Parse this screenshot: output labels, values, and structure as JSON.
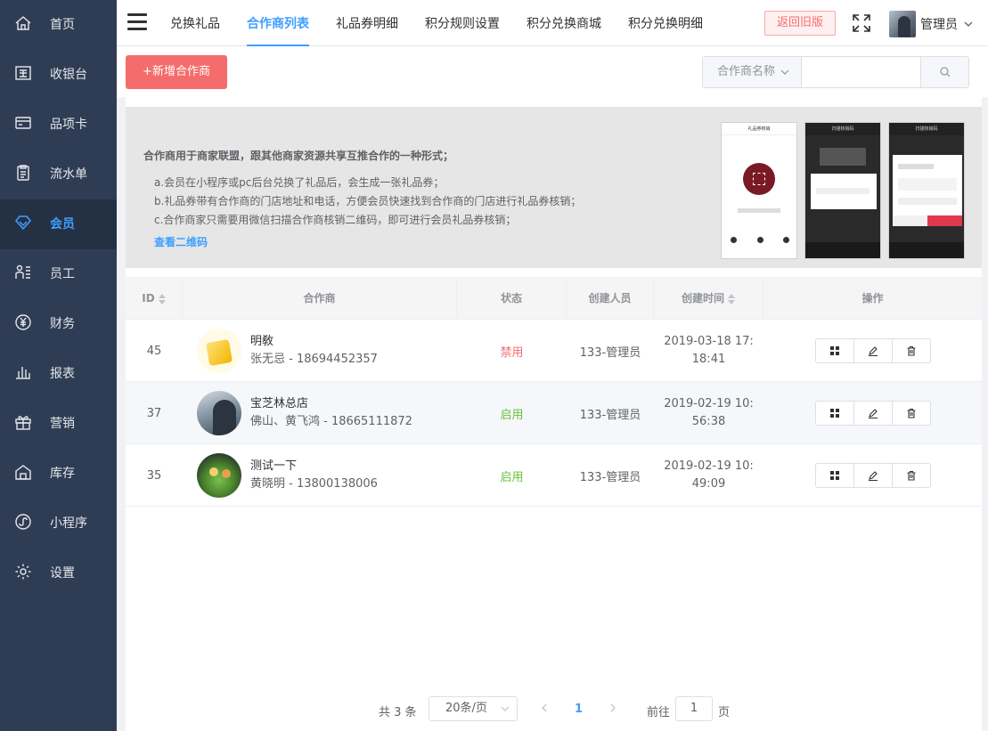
{
  "sidebar": {
    "items": [
      {
        "label": "首页",
        "icon": "home-icon",
        "active": false
      },
      {
        "label": "收银台",
        "icon": "cashier-icon",
        "active": false
      },
      {
        "label": "品项卡",
        "icon": "card-icon",
        "active": false
      },
      {
        "label": "流水单",
        "icon": "clipboard-icon",
        "active": false
      },
      {
        "label": "会员",
        "icon": "diamond-icon",
        "active": true
      },
      {
        "label": "员工",
        "icon": "staff-icon",
        "active": false
      },
      {
        "label": "财务",
        "icon": "yen-icon",
        "active": false
      },
      {
        "label": "报表",
        "icon": "bar-chart-icon",
        "active": false
      },
      {
        "label": "营销",
        "icon": "gift-icon",
        "active": false
      },
      {
        "label": "库存",
        "icon": "warehouse-icon",
        "active": false
      },
      {
        "label": "小程序",
        "icon": "mini-program-icon",
        "active": false
      },
      {
        "label": "设置",
        "icon": "gear-icon",
        "active": false
      }
    ]
  },
  "header": {
    "tabs": [
      {
        "label": "兑换礼品",
        "active": false
      },
      {
        "label": "合作商列表",
        "active": true
      },
      {
        "label": "礼品券明细",
        "active": false
      },
      {
        "label": "积分规则设置",
        "active": false
      },
      {
        "label": "积分兑换商城",
        "active": false
      },
      {
        "label": "积分兑换明细",
        "active": false
      }
    ],
    "back_label": "返回旧版",
    "user_name": "管理员"
  },
  "toolbar": {
    "add_label": "+新增合作商",
    "search_field_label": "合作商名称",
    "search_value": ""
  },
  "info": {
    "title": "合作商用于商家联盟，跟其他商家资源共享互推合作的一种形式；",
    "lines": [
      "a.会员在小程序或pc后台兑换了礼品后，会生成一张礼品券；",
      "b.礼品券带有合作商的门店地址和电话，方便会员快速找到合作商的门店进行礼品券核销；",
      "c.合作商家只需要用微信扫描合作商核销二维码，即可进行会员礼品券核销；"
    ],
    "link_label": "查看二维码",
    "screen1_title": "礼品券核销",
    "screen2_title": "扫描核销码",
    "screen3_title": "扫描核销码"
  },
  "table": {
    "columns": [
      "ID",
      "合作商",
      "状态",
      "创建人员",
      "创建时间",
      "操作"
    ],
    "rows": [
      {
        "id": "45",
        "name": "明敎",
        "contact": "张无忌 - 18694452357",
        "status": "禁用",
        "creator": "133-管理员",
        "time": "2019-03-18 17:18:41"
      },
      {
        "id": "37",
        "name": "宝芝林总店",
        "contact": "佛山、黄飞鸿 - 18665111872",
        "status": "启用",
        "creator": "133-管理员",
        "time": "2019-02-19 10:56:38"
      },
      {
        "id": "35",
        "name": "测试一下",
        "contact": "黄晓明 - 13800138006",
        "status": "启用",
        "creator": "133-管理员",
        "time": "2019-02-19 10:49:09"
      }
    ]
  },
  "pagination": {
    "total_label": "共 3 条",
    "page_size_label": "20条/页",
    "current_page": "1",
    "goto_label": "前往",
    "goto_value": "1",
    "page_suffix": "页"
  },
  "colors": {
    "sidebar_bg": "#2f3d54",
    "accent": "#409eff",
    "danger": "#f56c6c",
    "success": "#67c23a"
  }
}
